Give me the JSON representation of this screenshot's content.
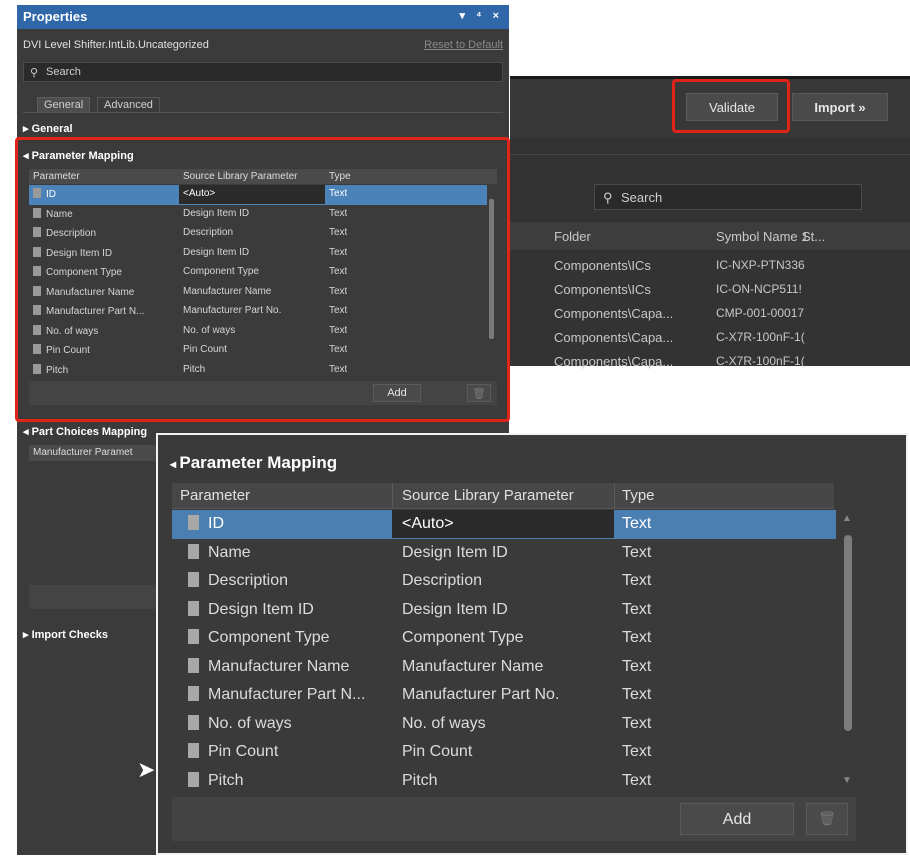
{
  "properties": {
    "title": "Properties",
    "window_controls": "▾ ⁴ ×",
    "subtitle": "DVI Level Shifter.IntLib.Uncategorized",
    "reset_link": "Reset to Default",
    "search_placeholder": "Search",
    "tabs": [
      "General",
      "Advanced"
    ],
    "sections": {
      "general": "General",
      "parameter_mapping": "Parameter Mapping",
      "part_choices_mapping": "Part Choices Mapping",
      "part_choices_column": "Manufacturer Paramet",
      "import_checks": "Import Checks"
    },
    "columns": [
      "Parameter",
      "Source Library Parameter",
      "Type"
    ],
    "rows": [
      {
        "parameter": "ID",
        "source": "<Auto>",
        "type": "Text"
      },
      {
        "parameter": "Name",
        "source": "Design Item ID",
        "type": "Text"
      },
      {
        "parameter": "Description",
        "source": "Description",
        "type": "Text"
      },
      {
        "parameter": "Design Item ID",
        "source": "Design Item ID",
        "type": "Text"
      },
      {
        "parameter": "Component Type",
        "source": "Component Type",
        "type": "Text"
      },
      {
        "parameter": "Manufacturer Name",
        "source": "Manufacturer Name",
        "type": "Text"
      },
      {
        "parameter": "Manufacturer Part N...",
        "source": "Manufacturer Part No.",
        "type": "Text"
      },
      {
        "parameter": "No. of ways",
        "source": "No. of ways",
        "type": "Text"
      },
      {
        "parameter": "Pin Count",
        "source": "Pin Count",
        "type": "Text"
      },
      {
        "parameter": "Pitch",
        "source": "Pitch",
        "type": "Text"
      }
    ],
    "add_label": "Add"
  },
  "library": {
    "validate_label": "Validate",
    "import_label": "Import »",
    "search_placeholder": "Search",
    "columns": [
      "Folder",
      "Symbol Name 1",
      "St..."
    ],
    "rows": [
      {
        "folder": "Components\\ICs",
        "symbol": "IC-NXP-PTN336"
      },
      {
        "folder": "Components\\ICs",
        "symbol": "IC-ON-NCP511!"
      },
      {
        "folder": "Components\\Capa...",
        "symbol": "CMP-001-00017"
      },
      {
        "folder": "Components\\Capa...",
        "symbol": "C-X7R-100nF-1("
      },
      {
        "folder": "Components\\Capa...",
        "symbol": "C-X7R-100nF-1("
      }
    ]
  },
  "zoom": {
    "section_title": "Parameter Mapping",
    "columns": [
      "Parameter",
      "Source Library Parameter",
      "Type"
    ],
    "add_label": "Add"
  },
  "colors": {
    "highlight_red": "#e02418",
    "selection_blue": "#4b82b8",
    "titlebar_blue": "#2f67a8"
  }
}
